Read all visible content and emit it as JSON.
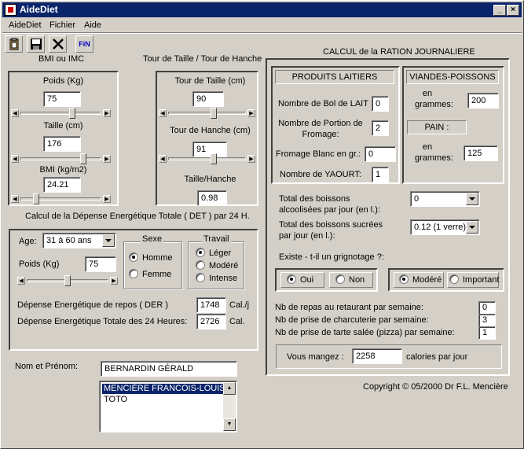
{
  "window": {
    "title": "AideDiet",
    "min_label": "_",
    "max_label": "□",
    "close_label": "×"
  },
  "menu": [
    "AideDiet",
    "Fichier",
    "Aide"
  ],
  "toolbar": {
    "fin_label": "FiN",
    "tools": [
      "clipboard-icon",
      "save-icon",
      "close-icon",
      "fin-icon"
    ]
  },
  "bmi": {
    "title": "BMI ou IMC",
    "poids_label": "Poids (Kg)",
    "poids_value": "75",
    "taille_label": "Taille (cm)",
    "taille_value": "176",
    "bmi_label": "BMI (kg/m2)",
    "bmi_value": "24.21"
  },
  "taille_hanche": {
    "title": "Tour de Taille / Tour de Hanche",
    "taille_label": "Tour de Taille (cm)",
    "taille_value": "90",
    "hanche_label": "Tour de Hanche (cm)",
    "hanche_value": "91",
    "ratio_label": "Taille/Hanche",
    "ratio_value": "0.98"
  },
  "det": {
    "title": "Calcul de la Dépense Energétique Totale ( DET ) par 24 H.",
    "age_label": "Age:",
    "age_value": "31 à 60 ans",
    "poids_label": "Poids (Kg)",
    "poids_value": "75",
    "sexe_title": "Sexe",
    "sexe_homme": "Homme",
    "sexe_femme": "Femme",
    "travail_title": "Travail",
    "travail_leger": "Léger",
    "travail_modere": "Modéré",
    "travail_intense": "Intense",
    "der_label": "Dépense Energétique de repos ( DER )",
    "der_value": "1748",
    "der_unit": "Cal./j",
    "det_label": "Dépense Energétique Totale des 24 Heures:",
    "det_value": "2726",
    "det_unit": "Cal."
  },
  "person": {
    "nom_label": "Nom et Prénom:",
    "nom_value": "BERNARDIN GÉRALD",
    "list": [
      "MENCIÈRE FRANCOIS-LOUIS",
      "TOTO"
    ]
  },
  "ration": {
    "title": "CALCUL de la RATION JOURNALIERE",
    "laitiers_title": "PRODUITS LAITIERS",
    "bol_label": "Nombre de Bol de LAIT :",
    "bol_value": "0",
    "fromage_label1": "Nombre de Portion de",
    "fromage_label2": "Fromage:",
    "fromage_value": "2",
    "blanc_label": "Fromage Blanc en gr.:",
    "blanc_value": "0",
    "yaourt_label": "Nombre de YAOURT:",
    "yaourt_value": "1",
    "viandes_title": "VIANDES-POISSONS",
    "viandes_en": "en",
    "viandes_grammes": "grammes:",
    "viandes_value": "200",
    "pain_title": "PAIN :",
    "pain_en": "en",
    "pain_grammes": "grammes:",
    "pain_value": "125",
    "alcool_label1": "Total des boissons",
    "alcool_label2": "alcoolisées par jour (en l.):",
    "alcool_value": "0",
    "sucre_label1": "Total des boissons sucrées",
    "sucre_label2": "par jour (en l.):",
    "sucre_value": "0.12 (1 verre)",
    "grignotage_label": "Existe - t-il un grignotage ?:",
    "oui": "Oui",
    "non": "Non",
    "modere": "Modéré",
    "important": "Important",
    "restaurant_label": "Nb de repas au retaurant par semaine:",
    "restaurant_value": "0",
    "charcuterie_label": "Nb de prise de charcuterie par semaine:",
    "charcuterie_value": "3",
    "tarte_label": "Nb de prise de tarte salée (pizza) par semaine:",
    "tarte_value": "1",
    "mangez_label": "Vous mangez :",
    "mangez_value": "2258",
    "mangez_unit": "calories par jour"
  },
  "copyright": "Copyright © 05/2000 Dr F.L. Mencière"
}
